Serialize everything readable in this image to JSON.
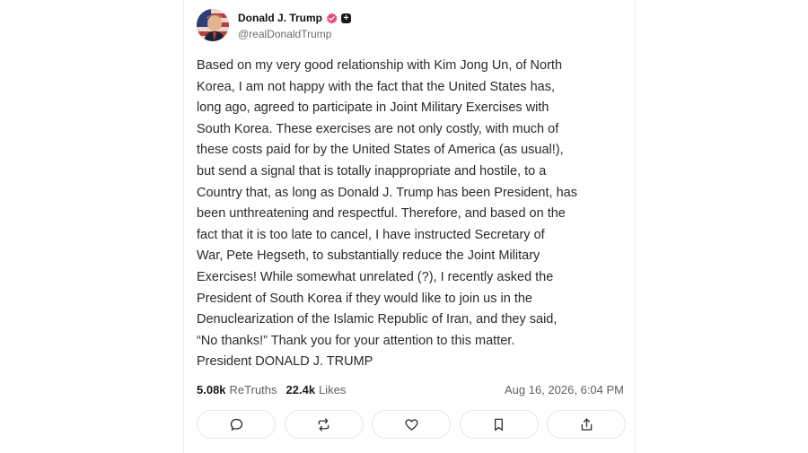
{
  "post": {
    "display_name": "Donald J. Trump",
    "handle": "@realDonaldTrump",
    "text": "Based on my very good relationship with Kim Jong Un, of North\nKorea, I am not happy with the fact that the United States has,\nlong ago, agreed to participate in Joint Military Exercises with\nSouth Korea. These exercises are not only costly, with much of\nthese costs paid for by the United States of America (as usual!),\nbut send a signal that is totally inappropriate and hostile, to a\nCountry that, as long as Donald J. Trump has been President, has\nbeen unthreatening and respectful. Therefore, and based on the\nfact that it is too late to cancel, I have instructed Secretary of\nWar, Pete Hegseth, to substantially reduce the Joint Military\nExercises! While somewhat unrelated (?), I recently asked the\nPresident of South Korea if they would like to join us in the\nDenuclearization of the Islamic Republic of Iran, and they said,\n“No thanks!” Thank you for your attention to this matter.\nPresident DONALD J. TRUMP",
    "retruths_count": "5.08k",
    "retruths_label": "ReTruths",
    "likes_count": "22.4k",
    "likes_label": "Likes",
    "timestamp": "Aug 16, 2026, 6:04 PM"
  },
  "badges": {
    "verified_color": "#e9487a",
    "plus_symbol": "+"
  },
  "actions": [
    {
      "icon": "reply-icon"
    },
    {
      "icon": "retruth-icon"
    },
    {
      "icon": "like-icon"
    },
    {
      "icon": "bookmark-icon"
    },
    {
      "icon": "share-icon"
    }
  ]
}
